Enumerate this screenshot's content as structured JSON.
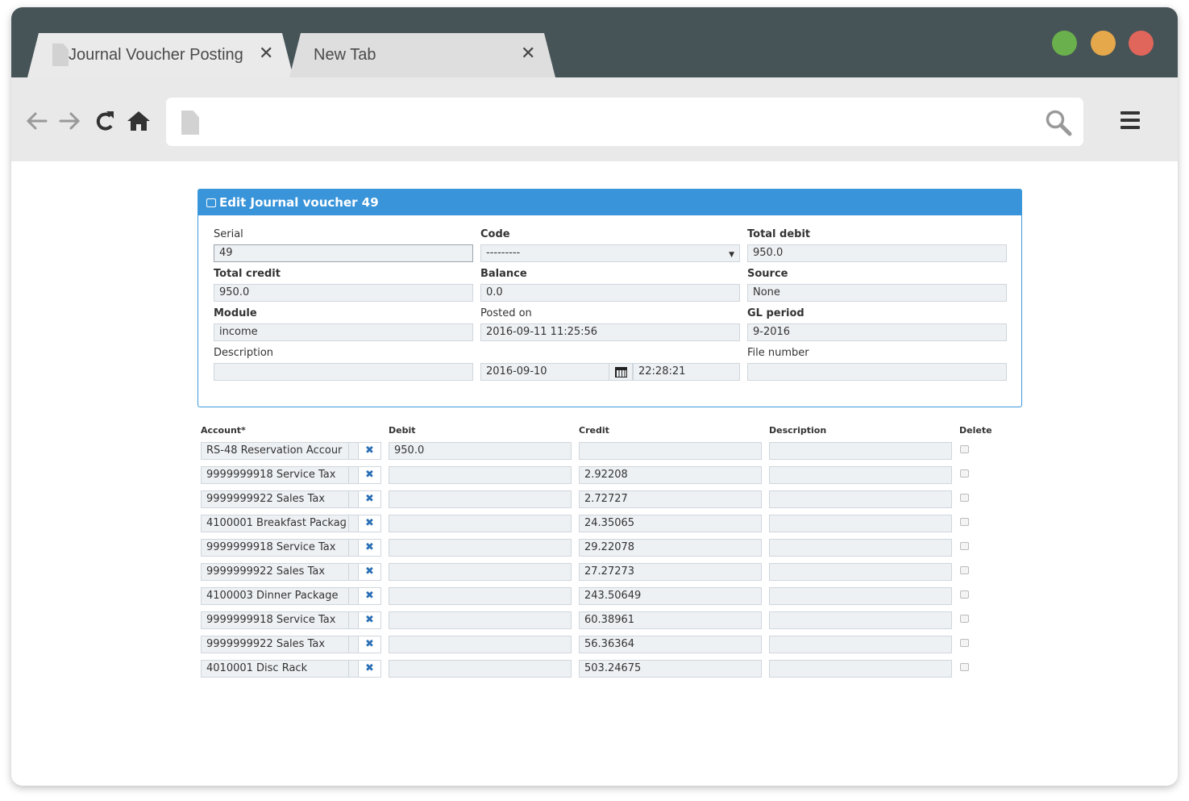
{
  "browser": {
    "tabs": [
      {
        "label": "Journal Voucher Posting",
        "close": "✕"
      },
      {
        "label": "New Tab",
        "close": "✕"
      }
    ],
    "address": {
      "value": ""
    },
    "colors": {
      "titlebar": "#465457",
      "green": "#6ab04c",
      "yellow": "#e5a84b",
      "red": "#e0655a"
    }
  },
  "form": {
    "title": "Edit Journal voucher 49",
    "serial": {
      "label": "Serial",
      "value": "49"
    },
    "code": {
      "label": "Code",
      "value": "---------"
    },
    "total_debit": {
      "label": "Total debit",
      "value": "950.0"
    },
    "total_credit": {
      "label": "Total credit",
      "value": "950.0"
    },
    "balance": {
      "label": "Balance",
      "value": "0.0"
    },
    "source": {
      "label": "Source",
      "value": "None"
    },
    "module": {
      "label": "Module",
      "value": "income"
    },
    "posted_on": {
      "label": "Posted on",
      "value": "2016-09-11 11:25:56"
    },
    "gl_period": {
      "label": "GL period",
      "value": "9-2016"
    },
    "description": {
      "label": "Description",
      "value": ""
    },
    "date": {
      "value": "2016-09-10"
    },
    "time": {
      "value": "22:28:21"
    },
    "file_number": {
      "label": "File number",
      "value": ""
    }
  },
  "lines": {
    "headers": {
      "account": "Account*",
      "debit": "Debit",
      "credit": "Credit",
      "description": "Description",
      "delete": "Delete"
    },
    "clear_symbol": "✖",
    "rows": [
      {
        "account": "RS-48 Reservation Accour",
        "debit": "950.0",
        "credit": "",
        "description": ""
      },
      {
        "account": "9999999918 Service Tax",
        "debit": "",
        "credit": "2.92208",
        "description": ""
      },
      {
        "account": "9999999922 Sales Tax",
        "debit": "",
        "credit": "2.72727",
        "description": ""
      },
      {
        "account": "4100001 Breakfast Packaɡ",
        "debit": "",
        "credit": "24.35065",
        "description": ""
      },
      {
        "account": "9999999918 Service Tax",
        "debit": "",
        "credit": "29.22078",
        "description": ""
      },
      {
        "account": "9999999922 Sales Tax",
        "debit": "",
        "credit": "27.27273",
        "description": ""
      },
      {
        "account": "4100003 Dinner Package",
        "debit": "",
        "credit": "243.50649",
        "description": ""
      },
      {
        "account": "9999999918 Service Tax",
        "debit": "",
        "credit": "60.38961",
        "description": ""
      },
      {
        "account": "9999999922 Sales Tax",
        "debit": "",
        "credit": "56.36364",
        "description": ""
      },
      {
        "account": "4010001 Disc Rack",
        "debit": "",
        "credit": "503.24675",
        "description": ""
      }
    ]
  }
}
